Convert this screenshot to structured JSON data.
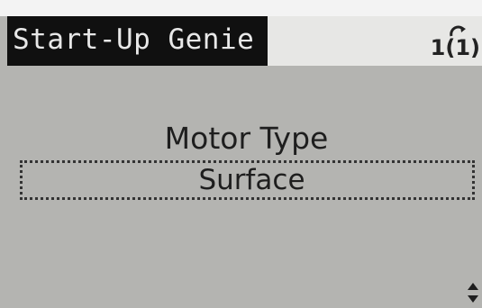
{
  "header": {
    "title": "Start-Up Genie",
    "menu_index": "1(1)",
    "menu_icon": "menu-arc-icon"
  },
  "parameter": {
    "label": "Motor Type",
    "value": "Surface"
  },
  "navigation": {
    "scroll_icon": "up-down-arrows-icon"
  },
  "colors": {
    "lcd_background": "#b4b4b1",
    "title_highlight": "#101010",
    "title_bar": "#e7e7e5",
    "text": "#1e1e1e"
  }
}
